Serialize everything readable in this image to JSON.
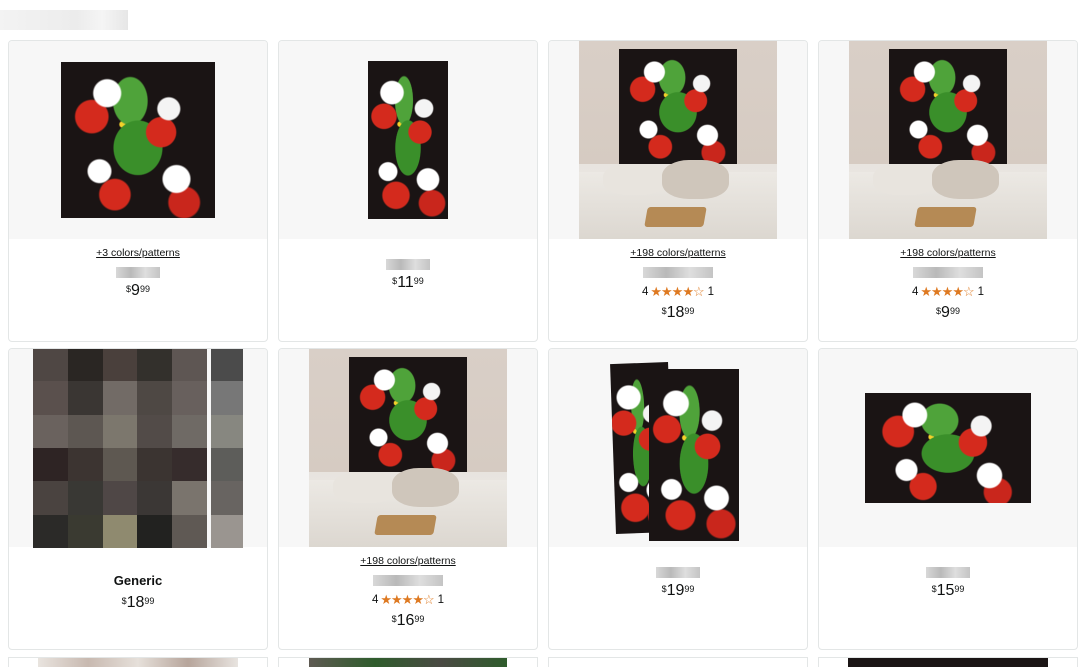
{
  "products": [
    {
      "colors": "+3 colors/patterns",
      "price": {
        "symbol": "$",
        "whole": "9",
        "fraction": "99"
      }
    },
    {
      "price": {
        "symbol": "$",
        "whole": "11",
        "fraction": "99"
      }
    },
    {
      "colors": "+198 colors/patterns",
      "rating": "4",
      "stars": "★★★★☆",
      "reviews": "1",
      "price": {
        "symbol": "$",
        "whole": "18",
        "fraction": "99"
      }
    },
    {
      "colors": "+198 colors/patterns",
      "rating": "4",
      "stars": "★★★★☆",
      "reviews": "1",
      "price": {
        "symbol": "$",
        "whole": "9",
        "fraction": "99"
      }
    },
    {
      "brand": "Generic",
      "price": {
        "symbol": "$",
        "whole": "18",
        "fraction": "99"
      }
    },
    {
      "colors": "+198 colors/patterns",
      "rating": "4",
      "stars": "★★★★☆",
      "reviews": "1",
      "price": {
        "symbol": "$",
        "whole": "16",
        "fraction": "99"
      }
    },
    {
      "price": {
        "symbol": "$",
        "whole": "19",
        "fraction": "99"
      }
    },
    {
      "price": {
        "symbol": "$",
        "whole": "15",
        "fraction": "99"
      }
    }
  ],
  "colors": {
    "star": "#de7921",
    "border": "#e3e6e6",
    "image_bg": "#f7f7f7"
  }
}
